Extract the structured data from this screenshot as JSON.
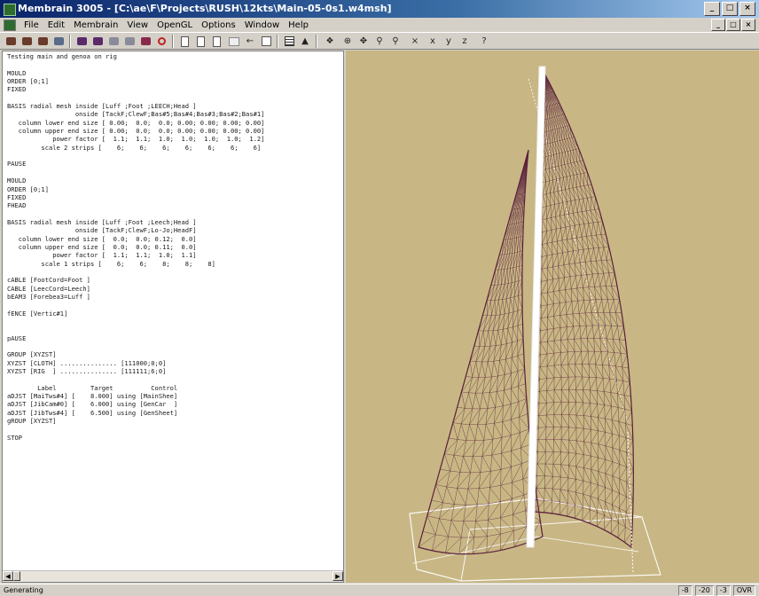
{
  "window": {
    "title": "Membrain 3005 - [C:\\ae\\F\\Projects\\RUSH\\12kts\\Main-05-0s1.w4msh]",
    "controls": [
      "_",
      "□",
      "×"
    ]
  },
  "menu": {
    "items": [
      "File",
      "Edit",
      "Membrain",
      "View",
      "OpenGL",
      "Options",
      "Window",
      "Help"
    ],
    "mdi_controls": [
      "_",
      "□",
      "×"
    ]
  },
  "toolbar": {
    "axis_x": "x",
    "axis_y": "y",
    "axis_z": "z"
  },
  "editor": {
    "lines": [
      "Testing main and genoa on rig",
      "",
      "MOULD",
      "ORDER [0;1]",
      "FIXED",
      "",
      "BASIS radial mesh inside [Luff ;Foot ;LEECH;Head ]",
      "                  onside [TackF;ClewF;Bas#5;Bas#4;Bas#3;Bas#2;Bas#1]",
      "   column lower end size [ 0.00;  0.0;  0.0; 0.00; 0.00; 0.00; 0.00]",
      "   column upper end size [ 0.00;  0.0;  0.0; 0.00; 0.00; 0.00; 0.00]",
      "            power factor [  1.1;  1.1;  1.0;  1.0;  1.0;  1.0;  1.2]",
      "         scale 2 strips [    6;    6;    6;    6;    6;    6;    6]",
      "",
      "PAUSE",
      "",
      "MOULD",
      "ORDER [0;1]",
      "FIXED",
      "FHEAD",
      "",
      "BASIS radial mesh inside [Luff ;Foot ;Leech;Head ]",
      "                  onside [TackF;ClewF;Lo-Jo;HeadF]",
      "   column lower end size [  0.0;  0.0; 0.12;  0.0]",
      "   column upper end size [  0.0;  0.0; 0.11;  0.0]",
      "            power factor [  1.1;  1.1;  1.0;  1.1]",
      "         scale 1 strips [    6;    6;    8;    8;    8]",
      "",
      "cABLE [FootCord=Foot ]",
      "CABLE [LeecCord=Leech]",
      "bEAM3 [Forebea3=Luff ]",
      "",
      "fENCE [Vertic#1]",
      "",
      "",
      "pAUSE",
      "",
      "GROUP [XYZST]",
      "XYZST [CLOTH] ............... [111000;0;0]",
      "XYZST [RIG  ] ............... [111111;6;0]",
      "",
      "        Label         Target          Control",
      "aDJST [MaiTws#4] [    8.000] using [MainShee]",
      "aDJST [JibCam#0] [    6.000] using [GenCar  ]",
      "aDJST [JibTws#4] [    6.500] using [GenSheet]",
      "gROUP [XYZST]",
      "",
      "STOP"
    ]
  },
  "status": {
    "left": "Generating",
    "cells": [
      "-8",
      "-20",
      "-3",
      "OVR"
    ]
  },
  "colors": {
    "viewport_bg": "#c8b784",
    "mesh": "#5a1f3c",
    "rig": "#ffffff"
  }
}
